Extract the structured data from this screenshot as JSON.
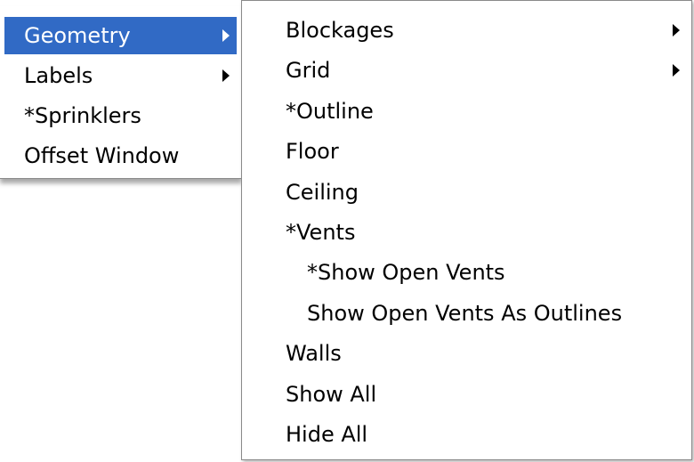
{
  "primary_menu": {
    "items": [
      {
        "label": "Geometry",
        "highlighted": true,
        "has_submenu": true
      },
      {
        "label": "Labels",
        "highlighted": false,
        "has_submenu": true
      },
      {
        "label": "*Sprinklers",
        "highlighted": false,
        "has_submenu": false
      },
      {
        "label": "Offset Window",
        "highlighted": false,
        "has_submenu": false
      }
    ],
    "highlight_color": "#316ac5"
  },
  "geometry_submenu": {
    "items": [
      {
        "label": "Blockages",
        "has_submenu": true
      },
      {
        "label": "Grid",
        "has_submenu": true
      },
      {
        "label": "*Outline",
        "has_submenu": false
      },
      {
        "label": "Floor",
        "has_submenu": false
      },
      {
        "label": "Ceiling",
        "has_submenu": false
      },
      {
        "label": "*Vents",
        "has_submenu": false
      },
      {
        "label": "*Show Open Vents",
        "has_submenu": false,
        "indented": true
      },
      {
        "label": "Show Open Vents As Outlines",
        "has_submenu": false,
        "indented": true
      },
      {
        "label": "Walls",
        "has_submenu": false
      },
      {
        "label": "Show All",
        "has_submenu": false
      },
      {
        "label": "Hide All",
        "has_submenu": false
      }
    ]
  },
  "icons": {
    "submenu_arrow": "submenu-arrow-icon"
  }
}
